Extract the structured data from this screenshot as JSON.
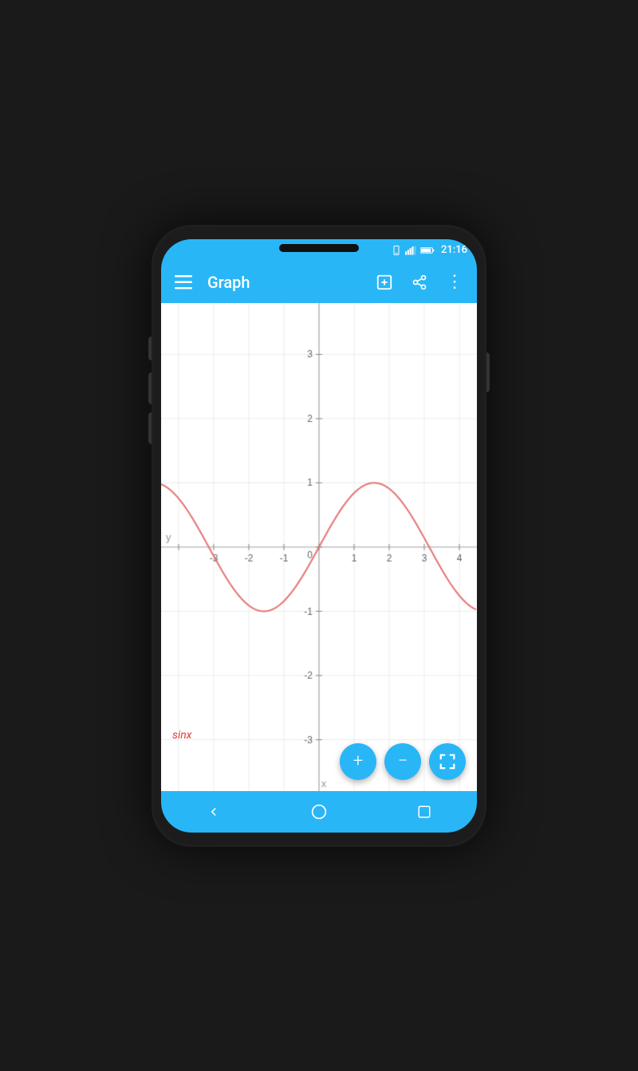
{
  "status_bar": {
    "time": "21:16",
    "icons": [
      "phone-icon",
      "signal-icon",
      "battery-icon"
    ]
  },
  "app_bar": {
    "menu_icon": "≡",
    "title": "Graph",
    "add_graph_icon": "⊞",
    "share_icon": "share",
    "more_icon": "⋮"
  },
  "graph": {
    "function_label": "sinx",
    "x_label": "x",
    "y_label": "y",
    "x_axis_values": [
      "-3",
      "-2",
      "-1",
      "0",
      "1",
      "2",
      "3",
      "4"
    ],
    "y_axis_values": [
      "3",
      "2",
      "1",
      "0",
      "-1",
      "-2",
      "-3"
    ],
    "curve_color": "#e57373",
    "grid_color": "#e0e0e0",
    "axis_color": "#bdbdbd"
  },
  "fab_buttons": {
    "zoom_in": "+",
    "zoom_out": "−",
    "fit": "⛶"
  },
  "nav_bar": {
    "back_icon": "◁",
    "home_icon": "○",
    "recents_icon": "□"
  }
}
